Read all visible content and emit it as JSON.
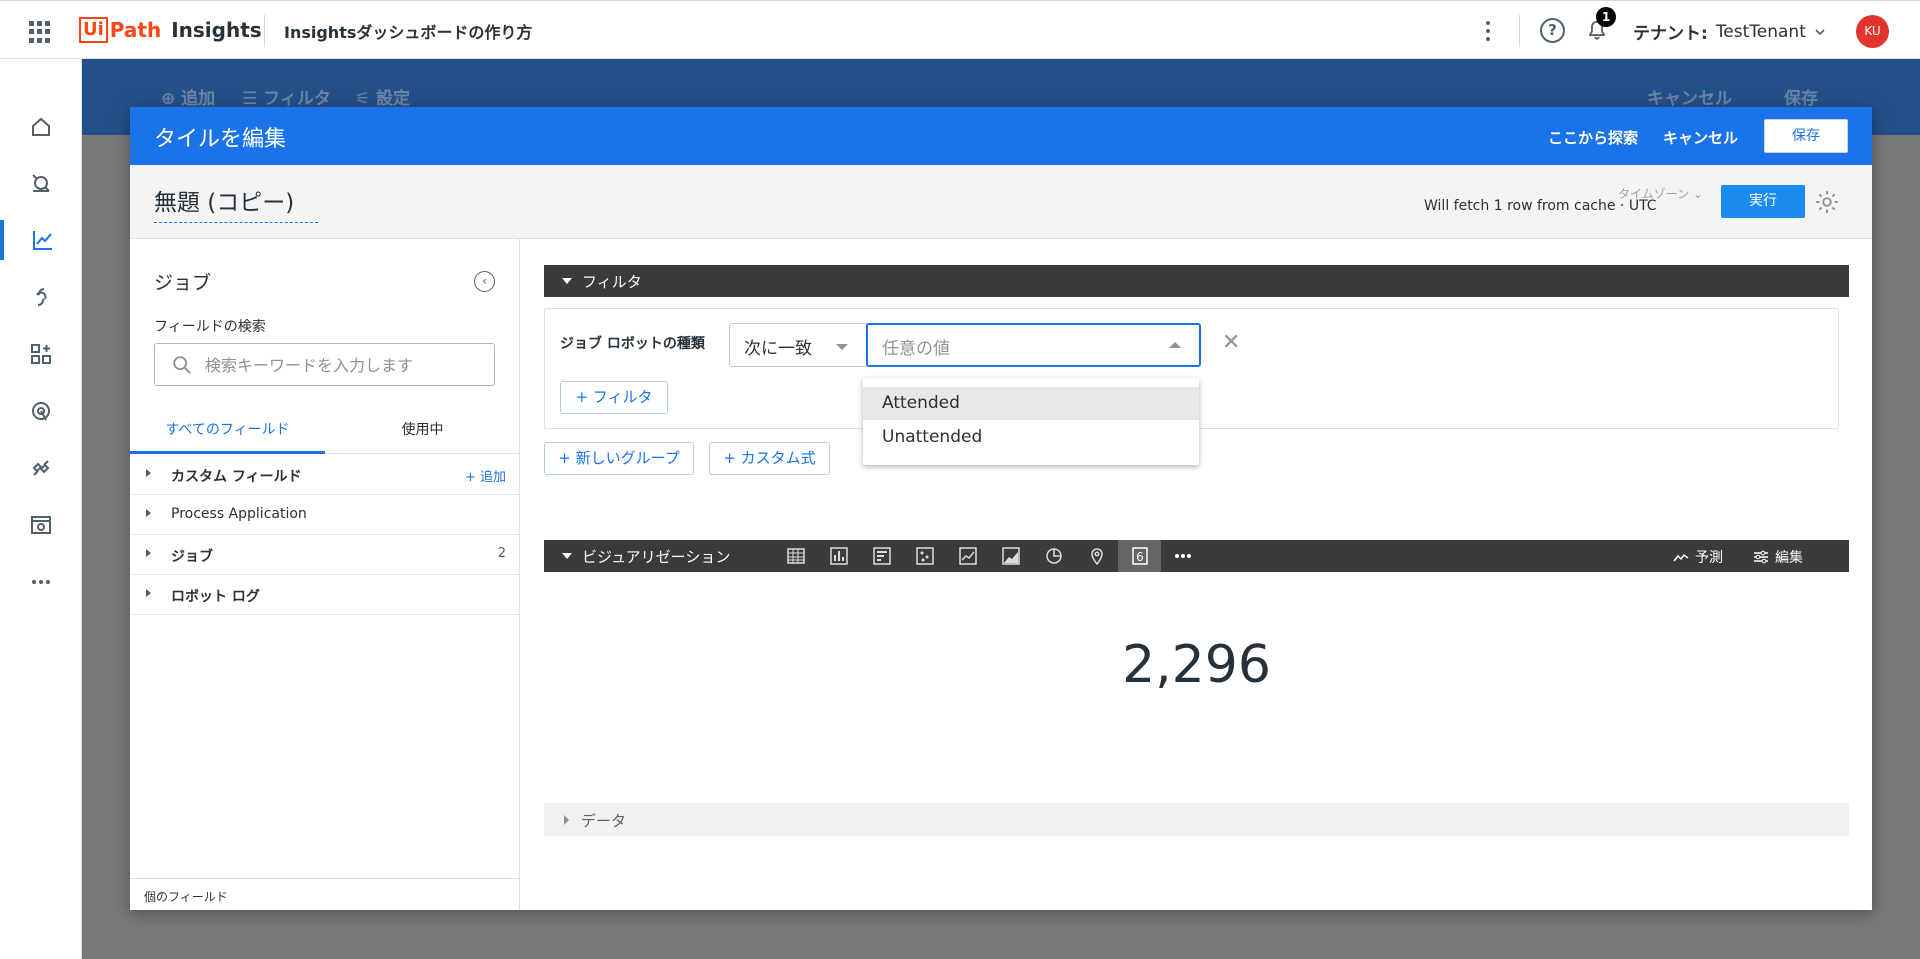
{
  "header": {
    "app_name_part1": "Ui",
    "app_name_part2": "Path",
    "app_name_part3": "Insights",
    "page_title": "Insightsダッシュボードの作り方",
    "notification_count": "1",
    "tenant_label": "テナント:",
    "tenant_name": "TestTenant",
    "avatar_initials": "KU"
  },
  "background_toolbar": {
    "add": "追加",
    "filter": "フィルタ",
    "settings": "設定",
    "cancel": "キャンセル",
    "save": "保存"
  },
  "modal": {
    "title": "タイルを編集",
    "explore_label": "ここから探索",
    "cancel_label": "キャンセル",
    "save_label": "保存",
    "tile_name": "無題 (コピー)",
    "timezone_label": "タイムゾーン",
    "cache_info": "Will fetch 1 row from cache · UTC",
    "run_label": "実行"
  },
  "left_panel": {
    "title": "ジョブ",
    "search_label": "フィールドの検索",
    "search_placeholder": "検索キーワードを入力します",
    "tabs": [
      "すべてのフィールド",
      "使用中"
    ],
    "fields": [
      {
        "label": "カスタム フィールド",
        "right": "+ 追加"
      },
      {
        "label": "Process Application",
        "right": ""
      },
      {
        "label": "ジョブ",
        "right": "2"
      },
      {
        "label": "ロボット ログ",
        "right": ""
      }
    ],
    "footer": "個のフィールド"
  },
  "filters": {
    "section_title": "フィルタ",
    "field_label": "ジョブ ロボットの種類",
    "match_type": "次に一致",
    "value_placeholder": "任意の値",
    "add_filter": "+ フィルタ",
    "options": [
      "Attended",
      "Unattended"
    ],
    "new_group": "+ 新しいグループ",
    "custom_expr": "+ カスタム式"
  },
  "visualization": {
    "section_title": "ビジュアリゼーション",
    "forecast_label": "予測",
    "edit_label": "編集",
    "single_value_icon_label": "6",
    "value": "2,296",
    "data_label": "データ"
  },
  "colors": {
    "primary": "#1a73e8",
    "brand_orange": "#fa4616",
    "dark_bar": "#3a3b3c"
  }
}
